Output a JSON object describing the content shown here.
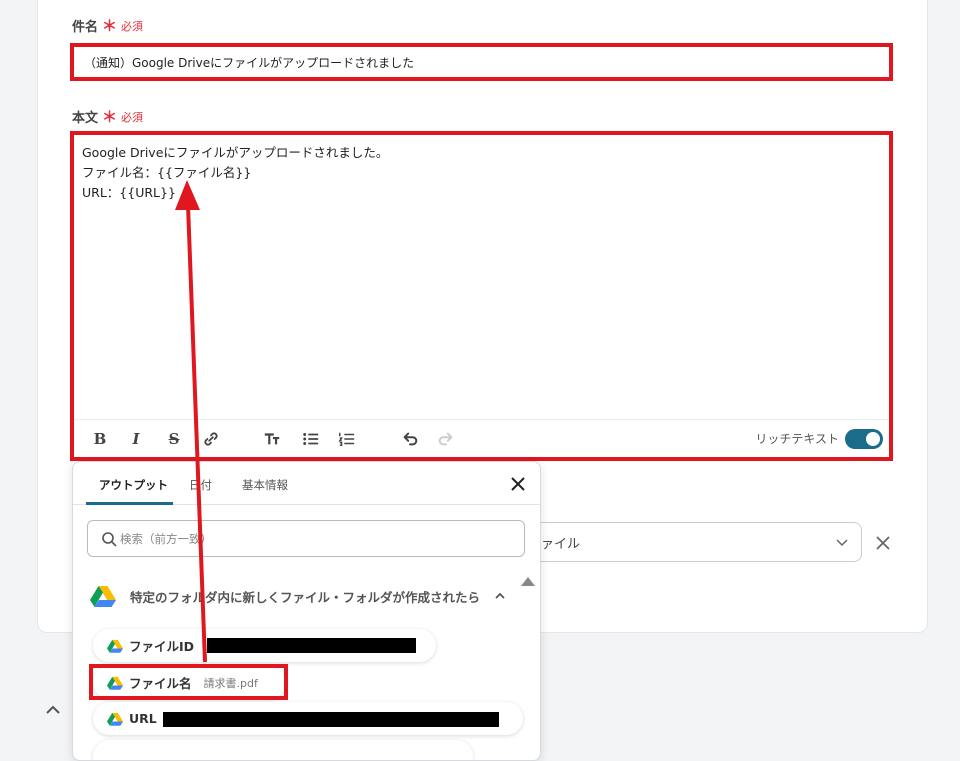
{
  "fields": {
    "subject": {
      "label": "件名",
      "required_mark": "＊",
      "required_text": "必須",
      "value": "（通知）Google Driveにファイルがアップロードされました"
    },
    "body": {
      "label": "本文",
      "required_mark": "＊",
      "required_text": "必須",
      "lines": [
        "Google Driveにファイルがアップロードされました。",
        "ファイル名：{{ファイル名}}",
        "URL：{{URL}}"
      ]
    }
  },
  "editor_toolbar": {
    "icons": [
      "bold-icon",
      "italic-icon",
      "strikethrough-icon",
      "link-icon",
      "text-size-icon",
      "bullet-list-icon",
      "numbered-list-icon",
      "undo-icon",
      "redo-icon"
    ],
    "rich_text_label": "リッチテキスト",
    "rich_text_enabled": true
  },
  "select": {
    "value_partial": "ァイル"
  },
  "popover": {
    "tabs": [
      "アウトプット",
      "日付",
      "基本情報"
    ],
    "active_tab": 0,
    "search_placeholder": "検索（前方一致）",
    "section_title": "特定のフォルダ内に新しくファイル・フォルダが作成されたら",
    "items": [
      {
        "label": "ファイルID",
        "value": ""
      },
      {
        "label": "ファイル名",
        "value": "請求書.pdf"
      },
      {
        "label": "URL",
        "value": ""
      }
    ]
  },
  "colors": {
    "highlight_red": "#e0171f",
    "accent": "#1b6c8a",
    "required_red": "#e0303a"
  }
}
